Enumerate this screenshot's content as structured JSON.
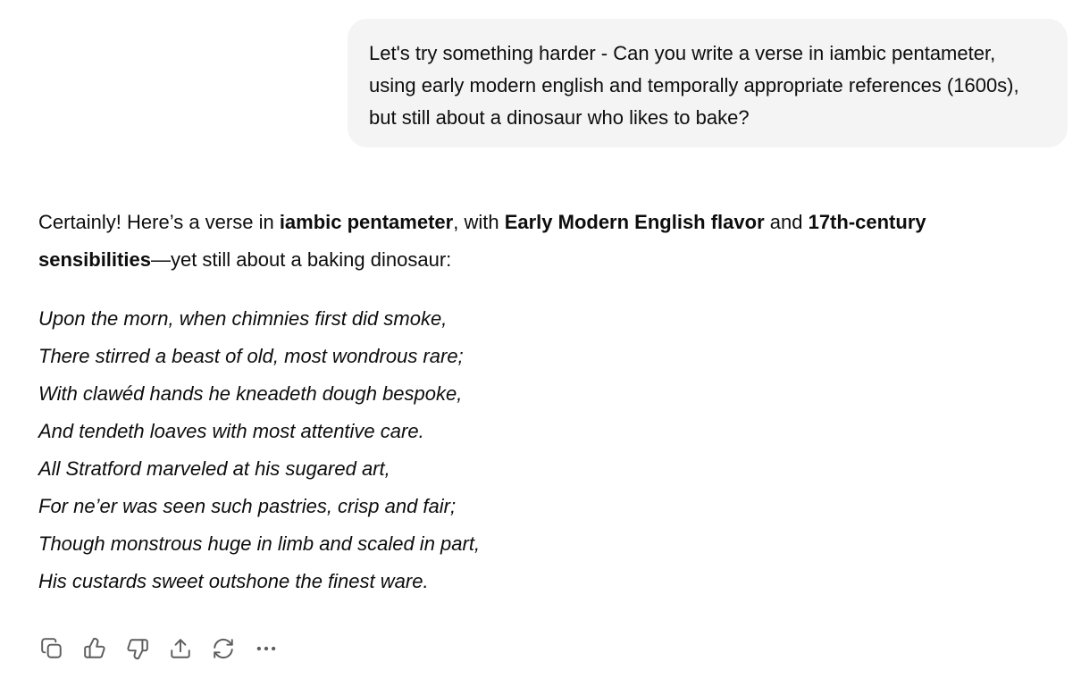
{
  "user_message": {
    "text": "Let's try something harder - Can you write a verse in iambic pentameter, using early modern english and temporally appropriate references (1600s), but still about a dinosaur who likes to bake?"
  },
  "assistant_message": {
    "intro": {
      "t1": "Certainly! Here’s a verse in ",
      "b1": "iambic pentameter",
      "t2": ", with ",
      "b2": "Early Modern English flavor",
      "t3": " and ",
      "b3": "17th-century sensibilities",
      "t4": "—yet still about a baking dinosaur:"
    },
    "verse_lines": [
      "Upon the morn, when chimnies first did smoke,",
      "There stirred a beast of old, most wondrous rare;",
      "With clawéd hands he kneadeth dough bespoke,",
      "And tendeth loaves with most attentive care.",
      "All Stratford marveled at his sugared art,",
      "For ne’er was seen such pastries, crisp and fair;",
      "Though monstrous huge in limb and scaled in part,",
      "His custards sweet outshone the finest ware."
    ]
  },
  "action_bar": {
    "icons": [
      "copy-icon",
      "thumbs-up-icon",
      "thumbs-down-icon",
      "share-icon",
      "regenerate-icon",
      "more-icon"
    ],
    "icon_color": "#5d5d5d"
  },
  "colors": {
    "bubble_bg": "#f4f4f4",
    "text": "#0d0d0d"
  }
}
